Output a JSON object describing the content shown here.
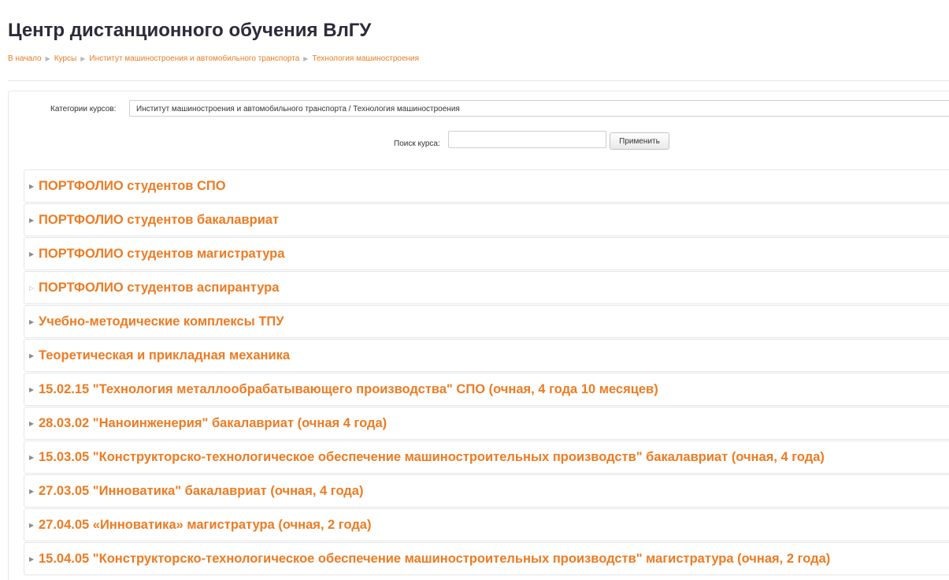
{
  "header": {
    "title": "Центр дистанционного обучения ВлГУ"
  },
  "breadcrumb": [
    {
      "label": "В начало"
    },
    {
      "label": "Курсы"
    },
    {
      "label": "Институт машиностроения и автомобильного транспорта"
    },
    {
      "label": "Технология машиностроения"
    }
  ],
  "filters": {
    "category_label": "Категории курсов:",
    "category_value": "Институт машиностроения и автомобильного транспорта / Технология машиностроения",
    "search_label": "Поиск курса:",
    "search_value": "",
    "apply_label": "Применить"
  },
  "categories": [
    {
      "name": "ПОРТФОЛИО студентов СПО",
      "expandable": true
    },
    {
      "name": "ПОРТФОЛИО студентов бакалавриат",
      "expandable": true
    },
    {
      "name": "ПОРТФОЛИО студентов магистратура",
      "expandable": true
    },
    {
      "name": "ПОРТФОЛИО студентов аспирантура",
      "expandable": false
    },
    {
      "name": "Учебно-методические комплексы ТПУ",
      "expandable": true
    },
    {
      "name": "Теоретическая и прикладная механика",
      "expandable": true
    },
    {
      "name": "15.02.15 \"Технология металлообрабатывающего производства\" СПО (очная, 4 года 10 месяцев)",
      "expandable": true
    },
    {
      "name": "28.03.02 \"Наноинженерия\" бакалавриат (очная 4 года)",
      "expandable": true
    },
    {
      "name": "15.03.05 \"Конструкторско-технологическое обеспечение машиностроительных производств\" бакалавриат (очная, 4 года)",
      "expandable": true
    },
    {
      "name": "27.03.05 \"Инноватика\" бакалавриат (очная, 4 года)",
      "expandable": true
    },
    {
      "name": "27.04.05 «Инноватика» магистратура (очная, 2 года)",
      "expandable": true
    },
    {
      "name": "15.04.05 \"Конструкторско-технологическое обеспечение машиностроительных производств\" магистратура (очная, 2 года)",
      "expandable": true
    }
  ],
  "colors": {
    "accent": "#ee7b22",
    "title": "#2b2b3a"
  },
  "icons": {
    "breadcrumb_separator": "breadcrumb-separator-icon",
    "expand": "expand-triangle-icon"
  }
}
